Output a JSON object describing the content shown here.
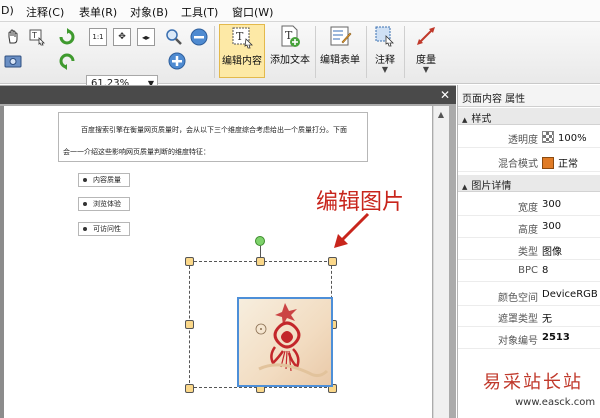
{
  "menubar": {
    "items": [
      "D)",
      "注释(C)",
      "表单(R)",
      "对象(B)",
      "工具(T)",
      "窗口(W)"
    ]
  },
  "toolbar": {
    "zoom_value": "61.23%",
    "buttons": {
      "edit_content": "编辑内容",
      "add_text": "添加文本",
      "edit_form": "编辑表单",
      "annotate": "注释",
      "measure": "度量"
    }
  },
  "document": {
    "text_lines": [
      "百度搜索引擎在衡量网页质量时，会从以下三个维度综合考虑给出一个质量打分。下面",
      "会一一介绍这些影响网页质量判断的维度特征："
    ],
    "bullets": [
      "内容质量",
      "浏览体验",
      "可访问性"
    ],
    "annotation": "编辑图片"
  },
  "panel": {
    "title": "页面内容 属性",
    "section_style": "样式",
    "section_image": "图片详情",
    "style_rows": [
      {
        "key": "透明度",
        "value": "100%"
      },
      {
        "key": "混合模式",
        "value": "正常"
      }
    ],
    "image_rows": [
      {
        "key": "宽度",
        "value": "300"
      },
      {
        "key": "高度",
        "value": "300"
      },
      {
        "key": "类型",
        "value": "图像"
      },
      {
        "key": "BPC",
        "value": "8"
      },
      {
        "key": "颜色空间",
        "value": "DeviceRGB"
      },
      {
        "key": "遮罩类型",
        "value": "无"
      },
      {
        "key": "对象编号",
        "value": "2513"
      }
    ]
  },
  "watermark": {
    "cn": "易采站长站",
    "url": "www.easck.com"
  },
  "colors": {
    "annotation_red": "#c8251c",
    "selection_handle": "#fbd88a",
    "active_button": "#fde9a6",
    "blend_swatch": "#e07b25"
  }
}
